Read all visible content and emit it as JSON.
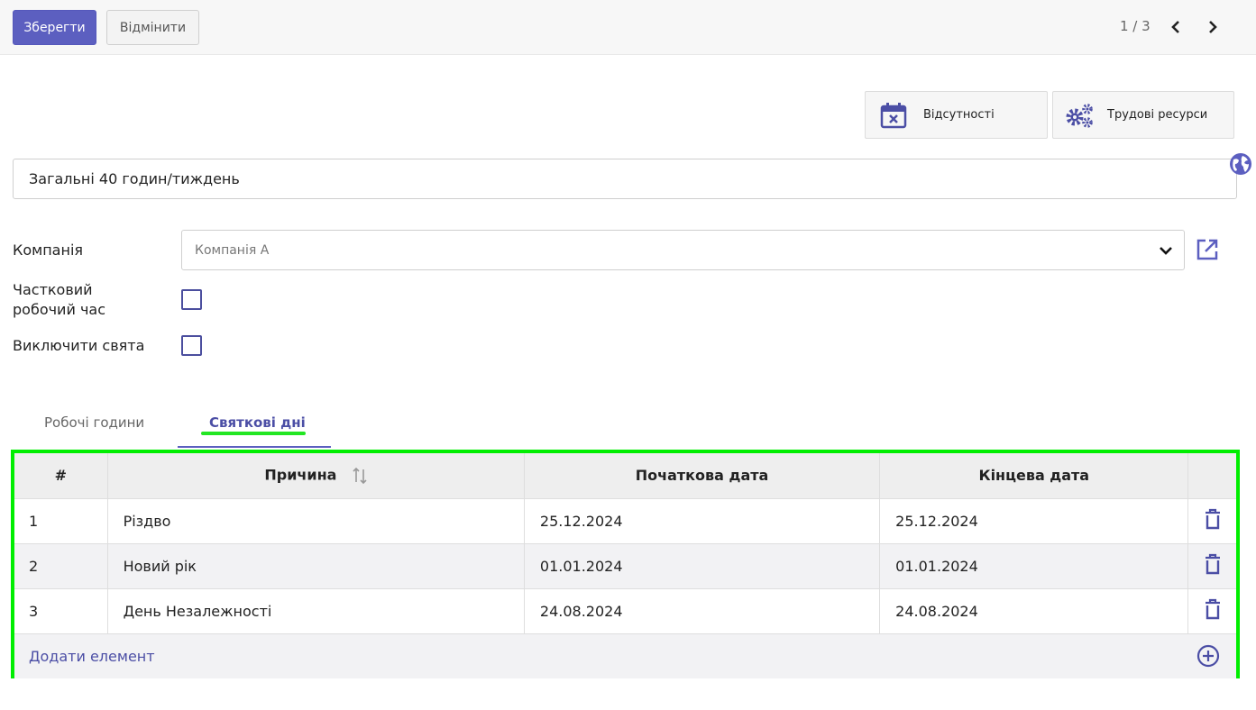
{
  "toolbar": {
    "save_label": "Зберегти",
    "discard_label": "Відмінити",
    "pager": "1 / 3"
  },
  "smart_buttons": {
    "absences_label": "Відсутності",
    "resources_label": "Трудові ресурси"
  },
  "form": {
    "name_value": "Загальні 40 годин/тиждень",
    "company_label": "Компанія",
    "company_value": "Компанія А",
    "part_time_label": "Частковий робочий час",
    "exclude_holidays_label": "Виключити свята",
    "part_time_checked": false,
    "exclude_holidays_checked": false
  },
  "tabs": [
    {
      "label": "Робочі години",
      "active": false
    },
    {
      "label": "Святкові дні",
      "active": true
    }
  ],
  "table": {
    "headers": [
      "#",
      "Причина",
      "Початкова дата",
      "Кінцева дата"
    ],
    "rows": [
      {
        "num": "1",
        "reason": "Різдво",
        "start": "25.12.2024",
        "end": "25.12.2024"
      },
      {
        "num": "2",
        "reason": "Новий рік",
        "start": "01.01.2024",
        "end": "01.01.2024"
      },
      {
        "num": "3",
        "reason": "День Незалежності",
        "start": "24.08.2024",
        "end": "24.08.2024"
      }
    ],
    "add_label": "Додати елемент"
  },
  "colors": {
    "accent": "#5c5fc0",
    "link": "#4b4ea5",
    "highlight": "#00ee00"
  },
  "icons": [
    "chevron-left-icon",
    "chevron-right-icon",
    "calendar-x-icon",
    "gears-icon",
    "globe-icon",
    "chevron-down-icon",
    "external-link-icon",
    "sort-icon",
    "trash-icon",
    "plus-circle-icon"
  ]
}
